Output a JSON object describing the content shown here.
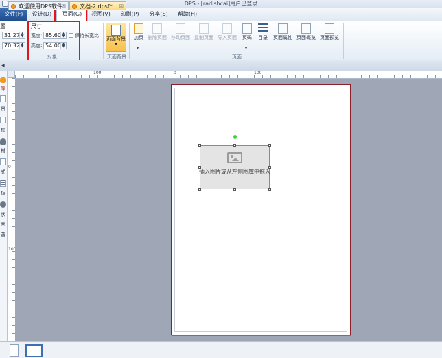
{
  "window": {
    "title": "DPS - [radishcai]用户已登录"
  },
  "menubar": {
    "items": [
      {
        "label": "文件(F)"
      },
      {
        "label": "设计(D)"
      },
      {
        "label": "页面(G)"
      },
      {
        "label": "视图(V)"
      },
      {
        "label": "印刷(P)"
      },
      {
        "label": "分享(S)"
      },
      {
        "label": "帮助(H)"
      }
    ]
  },
  "ribbon": {
    "position": {
      "label": "置",
      "x": "31.27",
      "y": "70.32"
    },
    "size": {
      "title": "尺寸",
      "width_label": "宽度",
      "width_value": "85.60",
      "height_label": "高度",
      "height_value": "54.00",
      "keep_ratio_label": "保持长宽比",
      "group_label": "对象"
    },
    "background": {
      "button_label": "页面背景",
      "group_label": "页面背景"
    },
    "page_group_label": "页面",
    "buttons": [
      {
        "label": "加页",
        "icon": "add-page-icon",
        "enabled": true
      },
      {
        "label": "删除页面",
        "icon": "delete-page-icon",
        "enabled": false
      },
      {
        "label": "移动页面",
        "icon": "move-page-icon",
        "enabled": false
      },
      {
        "label": "复制页面",
        "icon": "copy-page-icon",
        "enabled": false
      },
      {
        "label": "导入页面",
        "icon": "import-page-icon",
        "enabled": false
      },
      {
        "label": "页码",
        "icon": "page-number-icon",
        "enabled": true
      },
      {
        "label": "目录",
        "icon": "toc-icon",
        "enabled": true
      },
      {
        "label": "页面属性",
        "icon": "page-properties-icon",
        "enabled": true
      },
      {
        "label": "页面概览",
        "icon": "page-overview-icon",
        "enabled": true
      },
      {
        "label": "页面预览",
        "icon": "page-preview-icon",
        "enabled": true
      }
    ]
  },
  "tabs": [
    {
      "label": "欢迎使用DPS软件"
    },
    {
      "label": "文档-2 dpsf*"
    }
  ],
  "left_strip": {
    "items": [
      {
        "label": "库",
        "icon": "library-icon"
      },
      {
        "label": "景",
        "icon": "background-icon"
      },
      {
        "label": "框",
        "icon": "frame-icon"
      },
      {
        "label": "材",
        "icon": "material-icon"
      },
      {
        "label": "式",
        "icon": "style-icon"
      },
      {
        "label": "板",
        "icon": "template-icon"
      },
      {
        "label": "状",
        "icon": "shape-icon"
      },
      {
        "label": "藏",
        "icon": "favorite-icon"
      }
    ]
  },
  "ruler": {
    "h_labels": [
      "100",
      "0",
      "100"
    ],
    "v_labels": [
      "0",
      "100"
    ]
  },
  "canvas": {
    "placeholder_text": "插入图片或从左侧图库中拖入"
  },
  "colors": {
    "accent": "#1f4e8f",
    "highlight": "#e0161b",
    "canvas": "#9fa6b6"
  }
}
